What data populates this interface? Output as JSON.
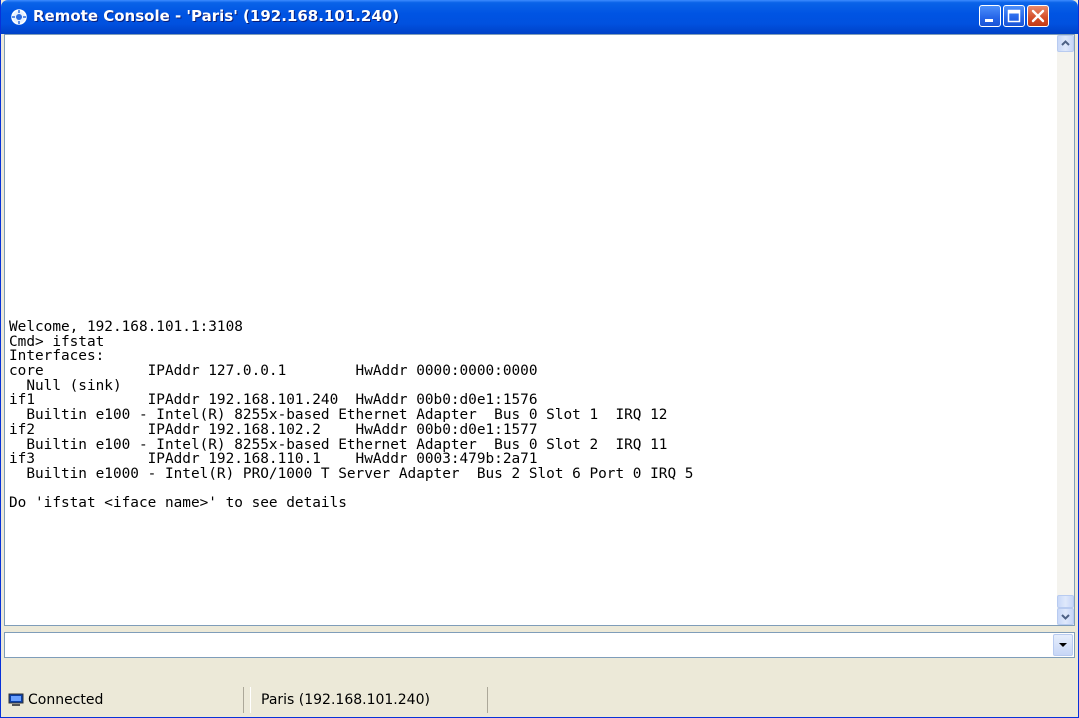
{
  "window": {
    "title": "Remote Console - 'Paris' (192.168.101.240)",
    "controls": {
      "minimize": "minimize",
      "maximize": "maximize",
      "close": "close"
    }
  },
  "console": {
    "lines": [
      "Welcome, 192.168.101.1:3108",
      "Cmd> ifstat",
      "Interfaces:",
      "core            IPAddr 127.0.0.1        HwAddr 0000:0000:0000",
      "  Null (sink)",
      "if1             IPAddr 192.168.101.240  HwAddr 00b0:d0e1:1576",
      "  Builtin e100 - Intel(R) 8255x-based Ethernet Adapter  Bus 0 Slot 1  IRQ 12",
      "if2             IPAddr 192.168.102.2    HwAddr 00b0:d0e1:1577",
      "  Builtin e100 - Intel(R) 8255x-based Ethernet Adapter  Bus 0 Slot 2  IRQ 11",
      "if3             IPAddr 192.168.110.1    HwAddr 0003:479b:2a71",
      "  Builtin e1000 - Intel(R) PRO/1000 T Server Adapter  Bus 2 Slot 6 Port 0 IRQ 5",
      "",
      "Do 'ifstat <iface name>' to see details"
    ]
  },
  "command_input": {
    "value": ""
  },
  "statusbar": {
    "status": "Connected",
    "host": "Paris (192.168.101.240)"
  },
  "icons": {
    "title": "remote-console-icon",
    "status": "computer-icon",
    "scroll_up": "chevron-up-icon",
    "scroll_down": "chevron-down-icon",
    "dropdown": "triangle-down-icon"
  },
  "colors": {
    "titlebar": "#0054e3",
    "close_button": "#d44d28",
    "window_bg": "#ece9d8"
  }
}
